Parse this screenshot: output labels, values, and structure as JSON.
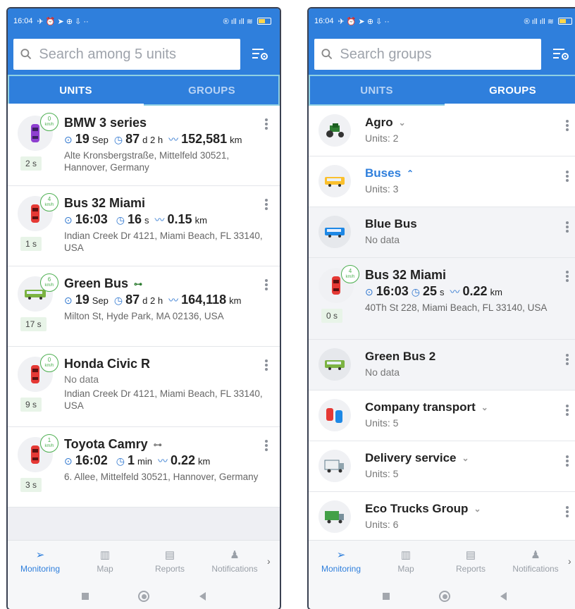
{
  "status_bar": {
    "time": "16:04",
    "icons_left": "✈ ⏰ ➤ ⊕ ⇩ ··",
    "icons_right": "® ıll ıll ≋"
  },
  "left": {
    "search_placeholder": "Search among 5 units",
    "tabs": {
      "units": "UNITS",
      "groups": "GROUPS"
    },
    "units": [
      {
        "name": "BMW 3 series",
        "speed": "0",
        "speed_unit": "km/h",
        "date": "19",
        "date_unit": "Sep",
        "dur": "87",
        "dur_unit": "d 2 h",
        "dist": "152,581",
        "dist_unit": "km",
        "address": "Alte Kronsbergstraße, Mittelfeld 30521, Hannover, Germany",
        "last": "2 s",
        "icon": "purple-car-icon"
      },
      {
        "name": "Bus 32 Miami",
        "speed": "4",
        "speed_unit": "km/h",
        "date": "16:03",
        "date_unit": "",
        "dur": "16",
        "dur_unit": "s",
        "dist": "0.15",
        "dist_unit": "km",
        "address": "Indian Creek Dr 4121, Miami Beach, FL 33140, USA",
        "last": "1 s",
        "icon": "red-car-icon"
      },
      {
        "name": "Green Bus",
        "speed": "6",
        "speed_unit": "km/h",
        "date": "19",
        "date_unit": "Sep",
        "dur": "87",
        "dur_unit": "d 2 h",
        "dist": "164,118",
        "dist_unit": "km",
        "address": "Milton St, Hyde Park, MA 02136, USA",
        "last": "17 s",
        "icon": "green-bus-icon"
      },
      {
        "name": "Honda Civic R",
        "speed": "0",
        "speed_unit": "km/h",
        "nodata": "No data",
        "address": "Indian Creek Dr 4121, Miami Beach, FL 33140, USA",
        "last": "9 s",
        "icon": "red-car-icon"
      },
      {
        "name": "Toyota Camry",
        "speed": "1",
        "speed_unit": "km/h",
        "date": "16:02",
        "date_unit": "",
        "dur": "1",
        "dur_unit": "min",
        "dist": "0.22",
        "dist_unit": "km",
        "address": "6. Allee, Mittelfeld 30521, Hannover, Germany",
        "last": "3 s",
        "icon": "red-car-icon"
      }
    ]
  },
  "right": {
    "search_placeholder": "Search groups",
    "tabs": {
      "units": "UNITS",
      "groups": "GROUPS"
    },
    "groups": [
      {
        "name": "Agro",
        "sub": "Units: 2",
        "expanded": false
      },
      {
        "name": "Buses",
        "sub": "Units: 3",
        "expanded": true
      },
      {
        "name": "Blue Bus",
        "sub": "No data"
      },
      {
        "name": "Green Bus 2",
        "sub": "No data"
      },
      {
        "name": "Company transport",
        "sub": "Units: 5"
      },
      {
        "name": "Delivery service",
        "sub": "Units: 5"
      },
      {
        "name": "Eco Trucks Group",
        "sub": "Units: 6"
      }
    ],
    "unit": {
      "name": "Bus 32 Miami",
      "speed": "4",
      "speed_unit": "km/h",
      "date": "16:03",
      "dur": "25",
      "dur_unit": "s",
      "dist": "0.22",
      "dist_unit": "km",
      "address": "40Th St 228, Miami Beach, FL 33140, USA",
      "last": "0 s"
    }
  },
  "nav": {
    "monitoring": "Monitoring",
    "map": "Map",
    "reports": "Reports",
    "notifications": "Notifications"
  },
  "colors": {
    "primary": "#2f7fdc",
    "accent_green": "#4caf50"
  }
}
